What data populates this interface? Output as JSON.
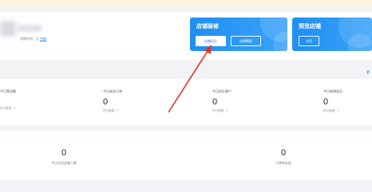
{
  "shop": {
    "expire_text": "到期时间：无",
    "renew_link": "升级"
  },
  "banners": {
    "decor": {
      "title": "店铺装修",
      "btn_primary": "店铺设计",
      "btn_secondary": "选择模板"
    },
    "preview": {
      "title": "预览店铺",
      "btn": "访问"
    }
  },
  "side_link": "更",
  "stats": [
    {
      "label": "今日营业额",
      "value": "",
      "sub": "昨日数据：0"
    },
    {
      "label": "今日成交订单",
      "value": "0",
      "sub": "昨日数据：0"
    },
    {
      "label": "今日成交客户",
      "value": "0",
      "sub": "昨日数据：0"
    },
    {
      "label": "今日新增会员",
      "value": "0",
      "sub": "昨日数据：0"
    }
  ],
  "bottom_stats": [
    {
      "value": "0",
      "label": "今日访问店铺人数"
    },
    {
      "value": "0",
      "label": "订单待处理"
    }
  ],
  "colors": {
    "accent": "#2b73ff",
    "banner": "#2e98f5",
    "arrow": "#e8322c"
  }
}
